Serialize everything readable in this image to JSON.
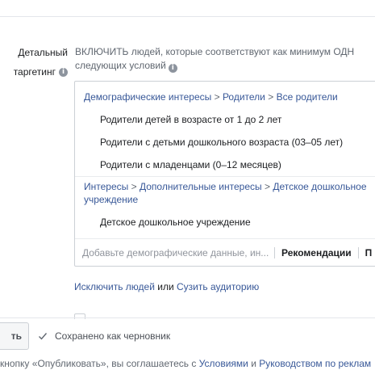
{
  "detailed_targeting": {
    "label_line1": "Детальный",
    "label_line2": "таргетинг",
    "header_line1": "ВКЛЮЧИТЬ людей, которые соответствуют как минимум ОДН",
    "header_line2": "следующих условий"
  },
  "groups": [
    {
      "crumbs": [
        "Демографические интересы",
        "Родители",
        "Все родители"
      ],
      "options": [
        "Родители детей в возрасте от 1 до 2 лет",
        "Родители с детьми дошкольного возраста (03–05 лет)",
        "Родители с младенцами (0–12 месяцев)"
      ]
    },
    {
      "crumbs_line1": [
        "Интересы",
        "Дополнительные интересы",
        "Детское дошкольное"
      ],
      "crumbs_line2": "учреждение",
      "options": [
        "Детское дошкольное учреждение"
      ]
    }
  ],
  "crumb_separator": ">",
  "search": {
    "placeholder": "Добавьте демографические данные, ин...",
    "recommendations": "Рекомендации",
    "browse": "П"
  },
  "exclude": {
    "exclude_link": "Исключить людей",
    "or_text": "или",
    "narrow_link": "Сузить аудиторию"
  },
  "footer_bar": {
    "publish_label": "ть",
    "saved_text": "Сохранено как черновник"
  },
  "legal": {
    "prefix": "кнопку «Опубликовать», вы соглашаетесь с",
    "terms_link": "Условиями",
    "and_text": "и",
    "guidelines_link": "Руководством по реклам"
  },
  "colors": {
    "link": "#385898",
    "border": "#ccd0d5",
    "muted": "#606770"
  },
  "icons": {
    "info": "info-icon",
    "check": "check-icon"
  }
}
